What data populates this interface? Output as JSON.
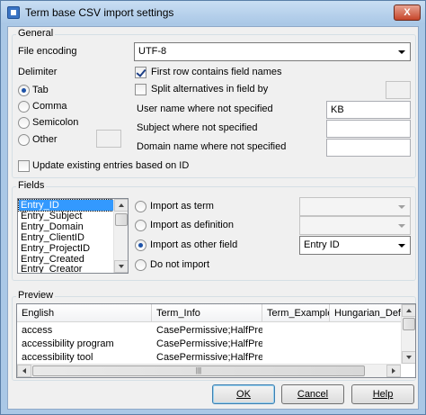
{
  "window": {
    "title": "Term base CSV import settings",
    "close_glyph": "X"
  },
  "general": {
    "group_label": "General",
    "file_encoding_label": "File encoding",
    "file_encoding_value": "UTF-8",
    "delimiter_label": "Delimiter",
    "delimiters": [
      {
        "label": "Tab",
        "selected": true
      },
      {
        "label": "Comma",
        "selected": false
      },
      {
        "label": "Semicolon",
        "selected": false
      },
      {
        "label": "Other",
        "selected": false
      }
    ],
    "first_row_label": "First row contains field names",
    "first_row_checked": true,
    "split_alternatives_label": "Split alternatives in field by",
    "split_alternatives_checked": false,
    "user_name_label": "User name where not specified",
    "user_name_value": "KB",
    "subject_label": "Subject where not specified",
    "subject_value": "",
    "domain_label": "Domain name where not specified",
    "domain_value": "",
    "update_existing_label": "Update existing entries based on ID",
    "update_existing_checked": false
  },
  "fields": {
    "group_label": "Fields",
    "items": [
      "Entry_ID",
      "Entry_Subject",
      "Entry_Domain",
      "Entry_ClientID",
      "Entry_ProjectID",
      "Entry_Created",
      "Entry_Creator"
    ],
    "selected_index": 0,
    "options": [
      {
        "label": "Import as term",
        "selected": false
      },
      {
        "label": "Import as definition",
        "selected": false
      },
      {
        "label": "Import as other field",
        "selected": true
      },
      {
        "label": "Do not import",
        "selected": false
      }
    ],
    "other_field_value": "Entry ID"
  },
  "preview": {
    "group_label": "Preview",
    "columns": [
      "English",
      "Term_Info",
      "Term_Example",
      "Hungarian_Def"
    ],
    "rows": [
      [
        "access",
        "CasePermissive;HalfPrefix",
        "",
        ""
      ],
      [
        "accessibility program",
        "CasePermissive;HalfPrefix",
        "",
        ""
      ],
      [
        "accessibility tool",
        "CasePermissive;HalfPrefix",
        "",
        ""
      ]
    ],
    "hscroll_grip": "|||"
  },
  "buttons": {
    "ok": "OK",
    "cancel": "Cancel",
    "help": "Help"
  },
  "colors": {
    "selection": "#3399ff",
    "title_bar": "#aac8e6",
    "dialog_bg": "#f0f0f0",
    "close_button": "#c6452a"
  }
}
